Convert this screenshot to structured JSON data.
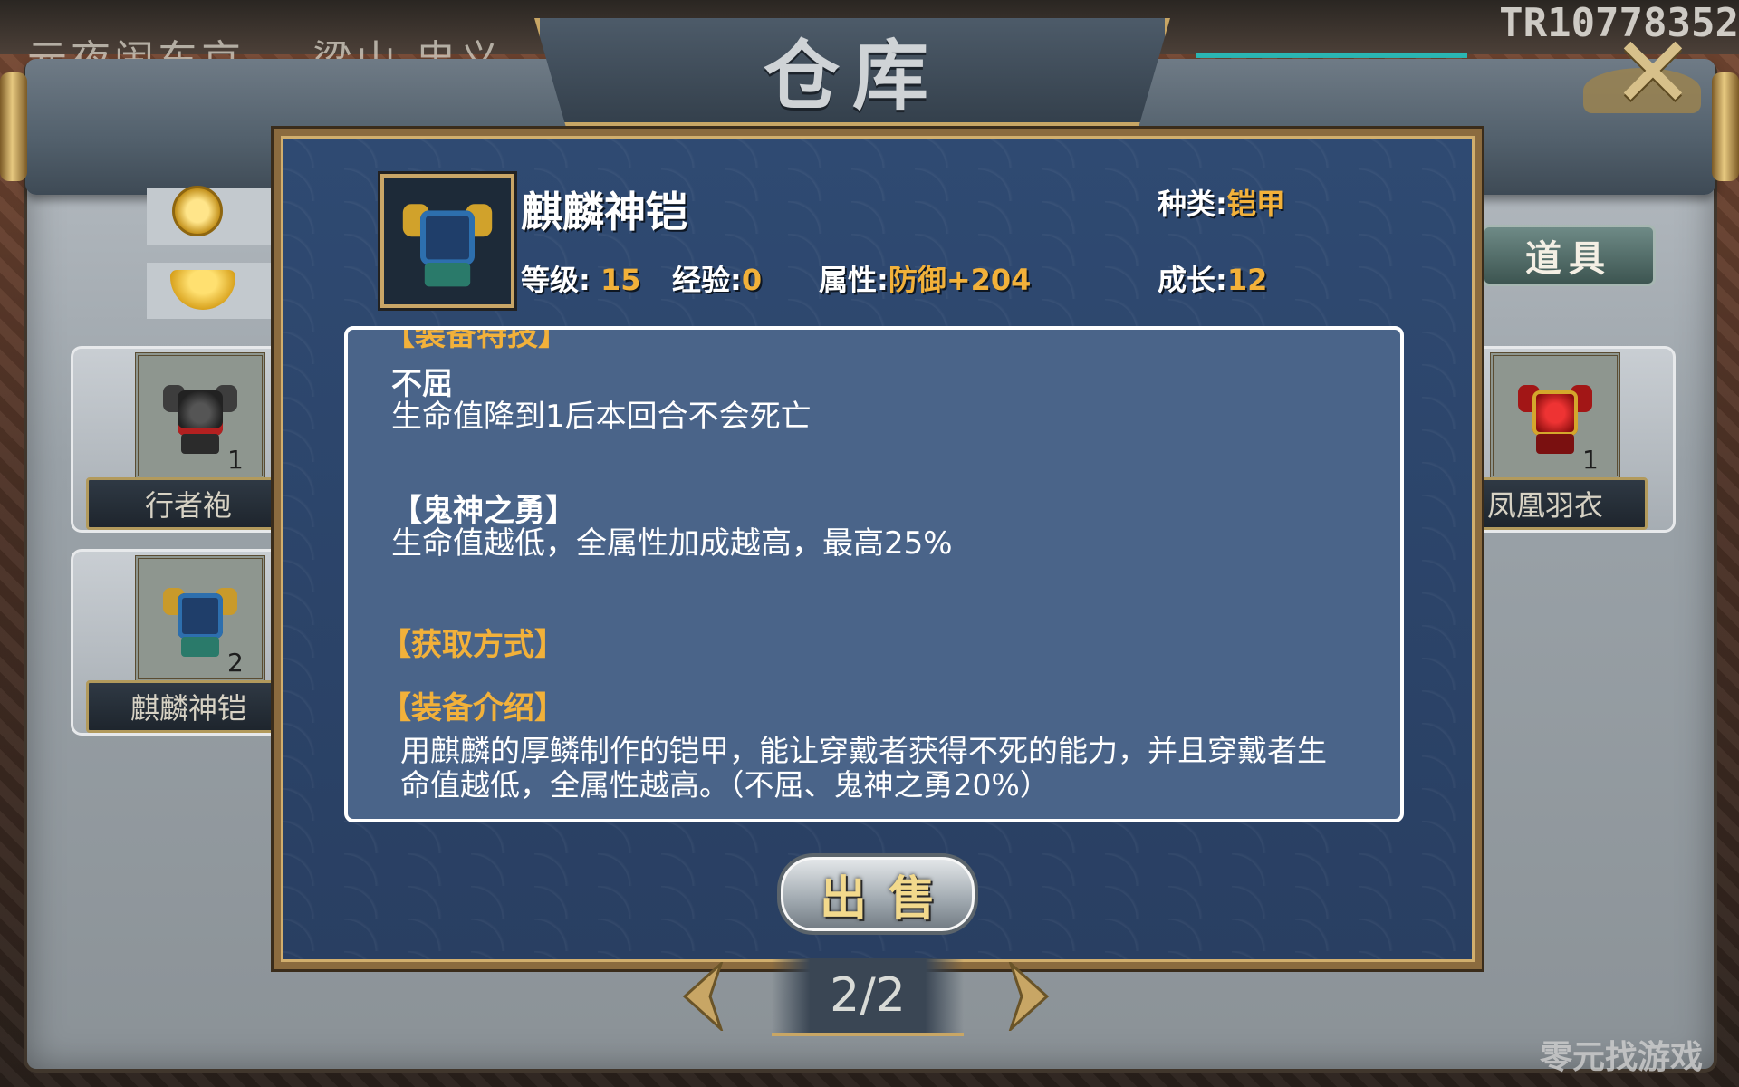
{
  "background": {
    "location_text": "元夜闹东京",
    "location_text2": "梁山 忠义",
    "player_id": "TR10778352"
  },
  "window": {
    "title": "仓库",
    "close_label": "✕",
    "tab_label": "道具"
  },
  "inventory": {
    "left_items": [
      {
        "name": "行者袍",
        "count": "1"
      },
      {
        "name": "麒麟神铠",
        "count": "2"
      }
    ],
    "right_items": [
      {
        "name": "凤凰羽衣",
        "count": "1"
      }
    ]
  },
  "detail": {
    "name": "麒麟神铠",
    "category_label": "种类:",
    "category_value": "铠甲",
    "level_label": "等级:",
    "level_value": "15",
    "exp_label": "经验:",
    "exp_value": "0",
    "attr_label": "属性:",
    "attr_value": "防御+204",
    "growth_label": "成长:",
    "growth_value": "12",
    "cut_header": "【装备特技】",
    "skill1_name": "不屈",
    "skill1_desc": "生命值降到1后本回合不会死亡",
    "skill2_name": "【鬼神之勇】",
    "skill2_desc": "生命值越低，全属性加成越高，最高25%",
    "source_header": "【获取方式】",
    "intro_header": "【装备介绍】",
    "intro_line1": "用麒麟的厚鳞制作的铠甲，能让穿戴者获得不死的能力，并且穿戴者生",
    "intro_line2": "命值越低，全属性越高。（不屈、鬼神之勇20%）"
  },
  "actions": {
    "sell_label": "出售"
  },
  "pagination": {
    "text": "2/2"
  },
  "watermark": {
    "text": "零元找游戏"
  },
  "colors": {
    "gold_value": "#f2b13a",
    "panel_blue": "#2f4a72",
    "frame_gold": "#c9a667"
  }
}
